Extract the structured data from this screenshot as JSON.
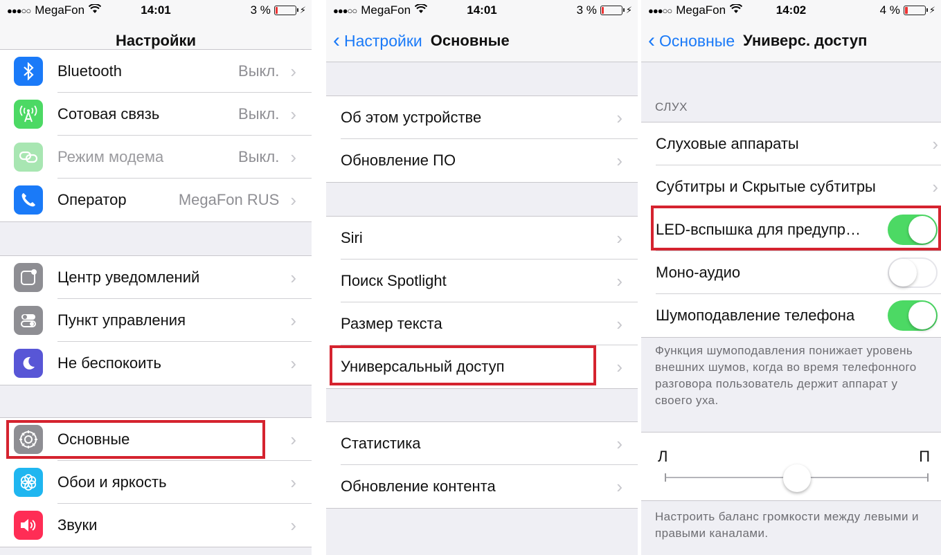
{
  "colors": {
    "accent": "#1a7af8",
    "toggle_on": "#4cd964",
    "highlight": "#d5232f"
  },
  "screens": [
    {
      "status": {
        "carrier": "MegaFon",
        "time": "14:01",
        "battery": "3 %",
        "battery_level": 0.03
      },
      "nav": {
        "title": "Настройки"
      },
      "groups": [
        {
          "rows": [
            {
              "label": "Bluetooth",
              "value": "Выкл.",
              "icon": "bluetooth-icon",
              "icon_color": "#1a7af8"
            },
            {
              "label": "Сотовая связь",
              "value": "Выкл.",
              "icon": "cellular-antenna-icon",
              "icon_color": "#4cd964"
            },
            {
              "label": "Режим модема",
              "value": "Выкл.",
              "icon": "hotspot-chain-icon",
              "icon_color": "#a8e6b2",
              "dimmed": true
            },
            {
              "label": "Оператор",
              "value": "MegaFon RUS",
              "icon": "phone-handset-icon",
              "icon_color": "#1a7af8"
            }
          ]
        },
        {
          "rows": [
            {
              "label": "Центр уведомлений",
              "icon": "notification-center-icon",
              "icon_color": "#8e8e93"
            },
            {
              "label": "Пункт управления",
              "icon": "control-center-toggles-icon",
              "icon_color": "#8e8e93"
            },
            {
              "label": "Не беспокоить",
              "icon": "moon-icon",
              "icon_color": "#5856d6"
            }
          ]
        },
        {
          "rows": [
            {
              "label": "Основные",
              "icon": "gear-icon",
              "icon_color": "#8e8e93",
              "highlighted": true
            },
            {
              "label": "Обои и яркость",
              "icon": "wallpaper-flower-icon",
              "icon_color": "#1fb6f0"
            },
            {
              "label": "Звуки",
              "icon": "speaker-icon",
              "icon_color": "#ff2d55"
            }
          ]
        }
      ]
    },
    {
      "status": {
        "carrier": "MegaFon",
        "time": "14:01",
        "battery": "3 %",
        "battery_level": 0.03
      },
      "nav": {
        "back": "Настройки",
        "title": "Основные"
      },
      "groups": [
        {
          "rows": [
            {
              "label": "Об этом устройстве"
            },
            {
              "label": "Обновление ПО"
            }
          ]
        },
        {
          "rows": [
            {
              "label": "Siri"
            },
            {
              "label": "Поиск Spotlight"
            },
            {
              "label": "Размер текста"
            },
            {
              "label": "Универсальный доступ",
              "highlighted": true
            }
          ]
        },
        {
          "rows": [
            {
              "label": "Статистика"
            },
            {
              "label": "Обновление контента"
            }
          ]
        }
      ]
    },
    {
      "status": {
        "carrier": "MegaFon",
        "time": "14:02",
        "battery": "4 %",
        "battery_level": 0.04
      },
      "nav": {
        "back": "Основные",
        "title": "Универс. доступ"
      },
      "section_header": "СЛУХ",
      "rows": [
        {
          "label": "Слуховые аппараты",
          "type": "chevron"
        },
        {
          "label": "Субтитры и Скрытые субтитры",
          "type": "chevron"
        },
        {
          "label": "LED-вспышка для предупр…",
          "type": "toggle",
          "on": true,
          "highlighted": true
        },
        {
          "label": "Моно-аудио",
          "type": "toggle",
          "on": false
        },
        {
          "label": "Шумоподавление телефона",
          "type": "toggle",
          "on": true
        }
      ],
      "footer": "Функция шумоподавления понижает уровень внешних шумов, когда во время телефонного разговора пользователь держит аппарат у своего уха.",
      "balance": {
        "left": "Л",
        "right": "П",
        "position": 0.5
      },
      "balance_footer": "Настроить баланс громкости между левыми и правыми каналами."
    }
  ]
}
